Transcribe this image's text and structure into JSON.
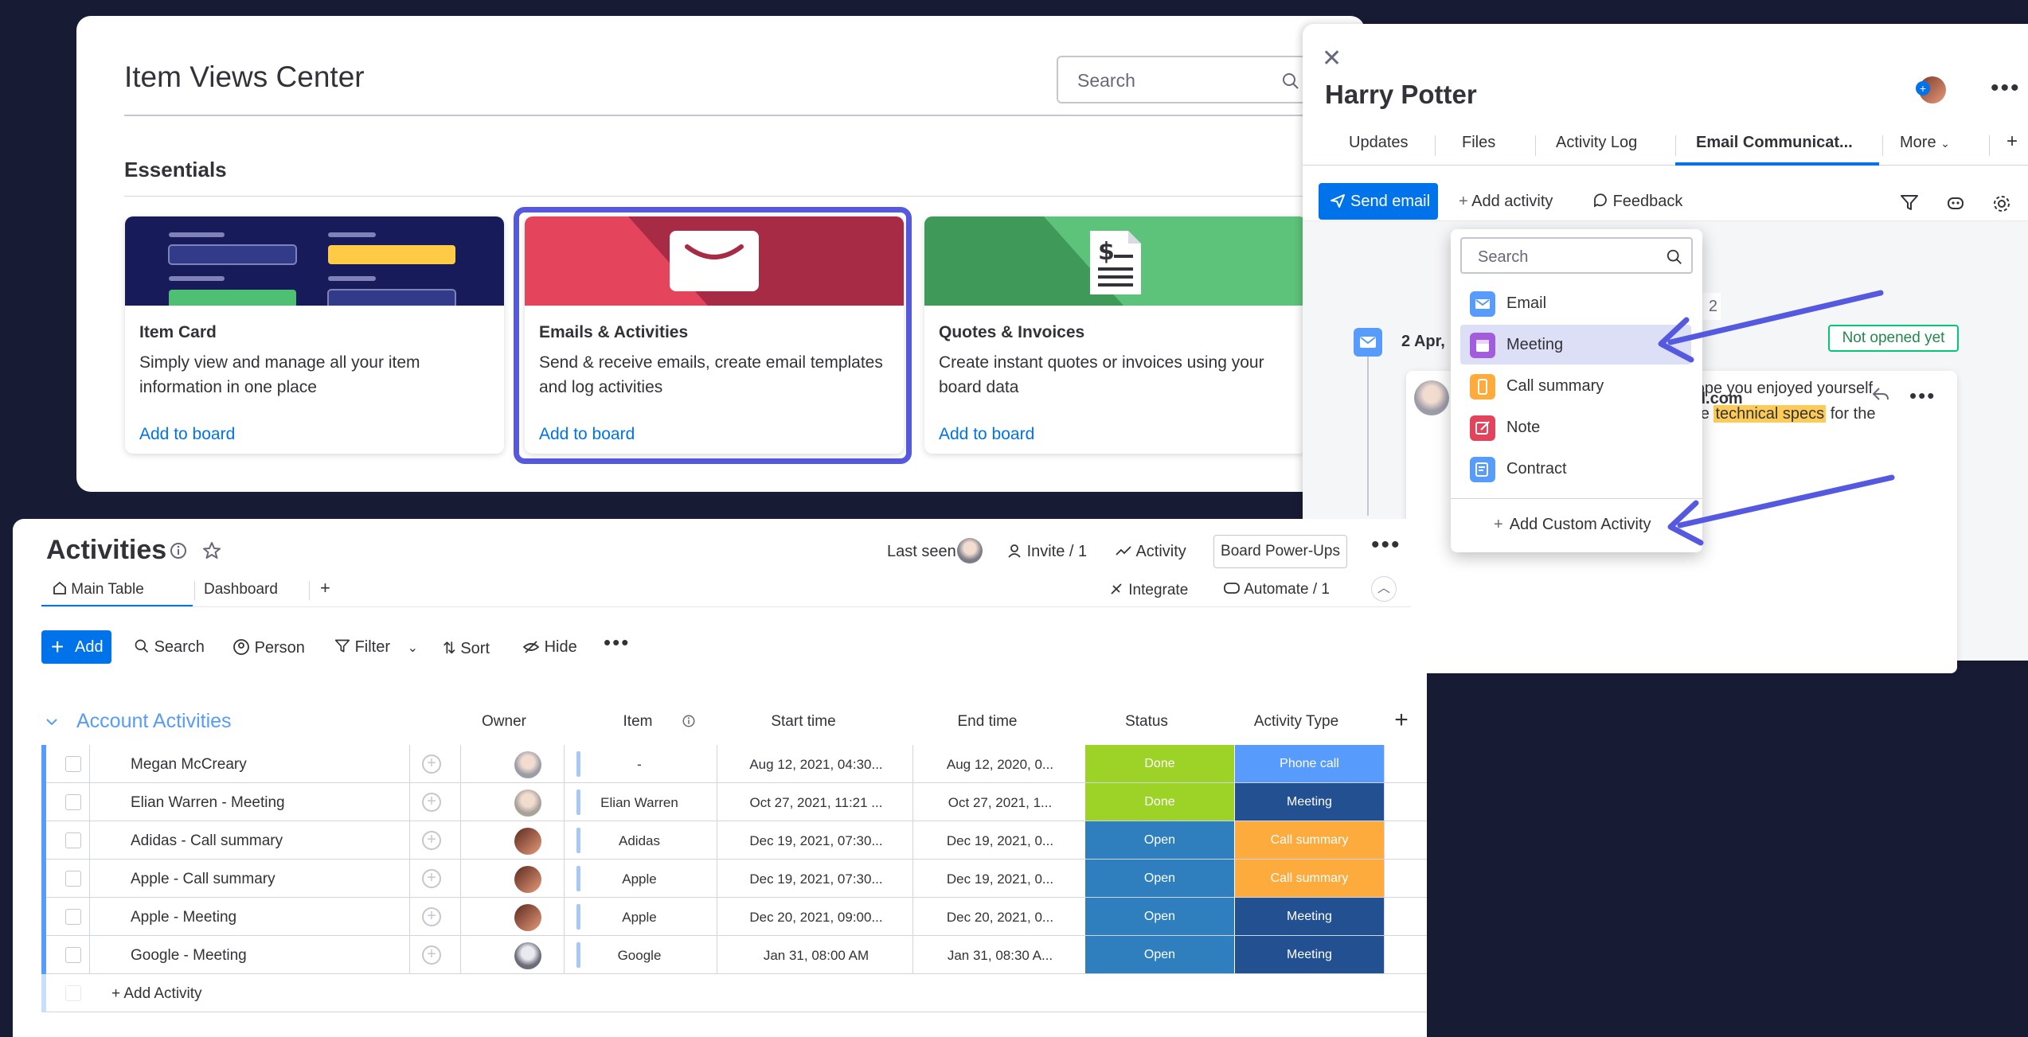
{
  "item_views_center": {
    "title": "Item Views Center",
    "search_placeholder": "Search",
    "section": "Essentials",
    "cards": [
      {
        "title": "Item Card",
        "description": "Simply view and manage all your item information in one place",
        "link": "Add to board"
      },
      {
        "title": "Emails & Activities",
        "description": "Send & receive emails, create email templates and log activities",
        "link": "Add to board"
      },
      {
        "title": "Quotes & Invoices",
        "description": "Create instant quotes or invoices using your board data",
        "link": "Add to board"
      }
    ]
  },
  "item_panel": {
    "name": "Harry Potter",
    "tabs": [
      "Updates",
      "Files",
      "Activity Log",
      "Email Communicat...",
      "More"
    ],
    "add_tab": "+",
    "toolbar": {
      "send_email": "Send email",
      "add_activity": "Add activity",
      "feedback": "Feedback"
    },
    "timeline": {
      "date": "2 Apr, ",
      "status": "Not opened yet",
      "partial_count": "2",
      "sender_partial": "mail.com",
      "message_before": "It was great to meet you, and I hope you enjoyed yourself as much as I did. I've attached the ",
      "message_highlight": "technical specs",
      "message_after": " for the budding project."
    },
    "activity_menu": {
      "search_placeholder": "Search",
      "items": [
        {
          "label": "Email",
          "color": "#579bfc",
          "icon": "email-icon"
        },
        {
          "label": "Meeting",
          "color": "#a25ddc",
          "icon": "calendar-icon"
        },
        {
          "label": "Call summary",
          "color": "#fdab3d",
          "icon": "phone-icon"
        },
        {
          "label": "Note",
          "color": "#e2445c",
          "icon": "note-icon"
        },
        {
          "label": "Contract",
          "color": "#579bfc",
          "icon": "contract-icon"
        }
      ],
      "selected": "Meeting",
      "custom": "Add Custom Activity"
    }
  },
  "board": {
    "title": "Activities",
    "last_seen": "Last seen",
    "invite": "Invite / 1",
    "activity": "Activity",
    "power_ups": "Board Power-Ups",
    "views": [
      "Main Table",
      "Dashboard"
    ],
    "add_view": "+",
    "integrate": "Integrate",
    "automate": "Automate / 1",
    "toolbar": {
      "add": "Add",
      "search": "Search",
      "person": "Person",
      "filter": "Filter",
      "sort": "Sort",
      "hide": "Hide"
    },
    "group": {
      "title": "Account Activities",
      "columns": [
        "Owner",
        "Item",
        "Start time",
        "End time",
        "Status",
        "Activity Type"
      ],
      "add_column": "+",
      "rows": [
        {
          "name": "Megan McCreary",
          "item": "-",
          "start": "Aug 12, 2021, 04:30...",
          "end": "Aug 12, 2020, 0...",
          "status": "Done",
          "type": "Phone call"
        },
        {
          "name": "Elian Warren - Meeting",
          "item": "Elian Warren",
          "start": "Oct 27, 2021, 11:21 ...",
          "end": "Oct 27, 2021, 1...",
          "status": "Done",
          "type": "Meeting"
        },
        {
          "name": "Adidas - Call summary",
          "item": "Adidas",
          "start": "Dec 19, 2021, 07:30...",
          "end": "Dec 19, 2021, 0...",
          "status": "Open",
          "type": "Call summary"
        },
        {
          "name": "Apple - Call summary",
          "item": "Apple",
          "start": "Dec 19, 2021, 07:30...",
          "end": "Dec 19, 2021, 0...",
          "status": "Open",
          "type": "Call summary"
        },
        {
          "name": "Apple - Meeting",
          "item": "Apple",
          "start": "Dec 20, 2021, 09:00...",
          "end": "Dec 20, 2021, 0...",
          "status": "Open",
          "type": "Meeting"
        },
        {
          "name": "Google - Meeting",
          "item": "Google",
          "start": "Jan 31, 08:00 AM",
          "end": "Jan 31, 08:30 A...",
          "status": "Open",
          "type": "Meeting"
        }
      ],
      "add_row": "+ Add Activity"
    },
    "colors": {
      "done": "#9cd326",
      "open": "#2f7fbf",
      "phone_call": "#579bfc",
      "meeting": "#225091",
      "call_summary": "#fdab3d"
    }
  }
}
